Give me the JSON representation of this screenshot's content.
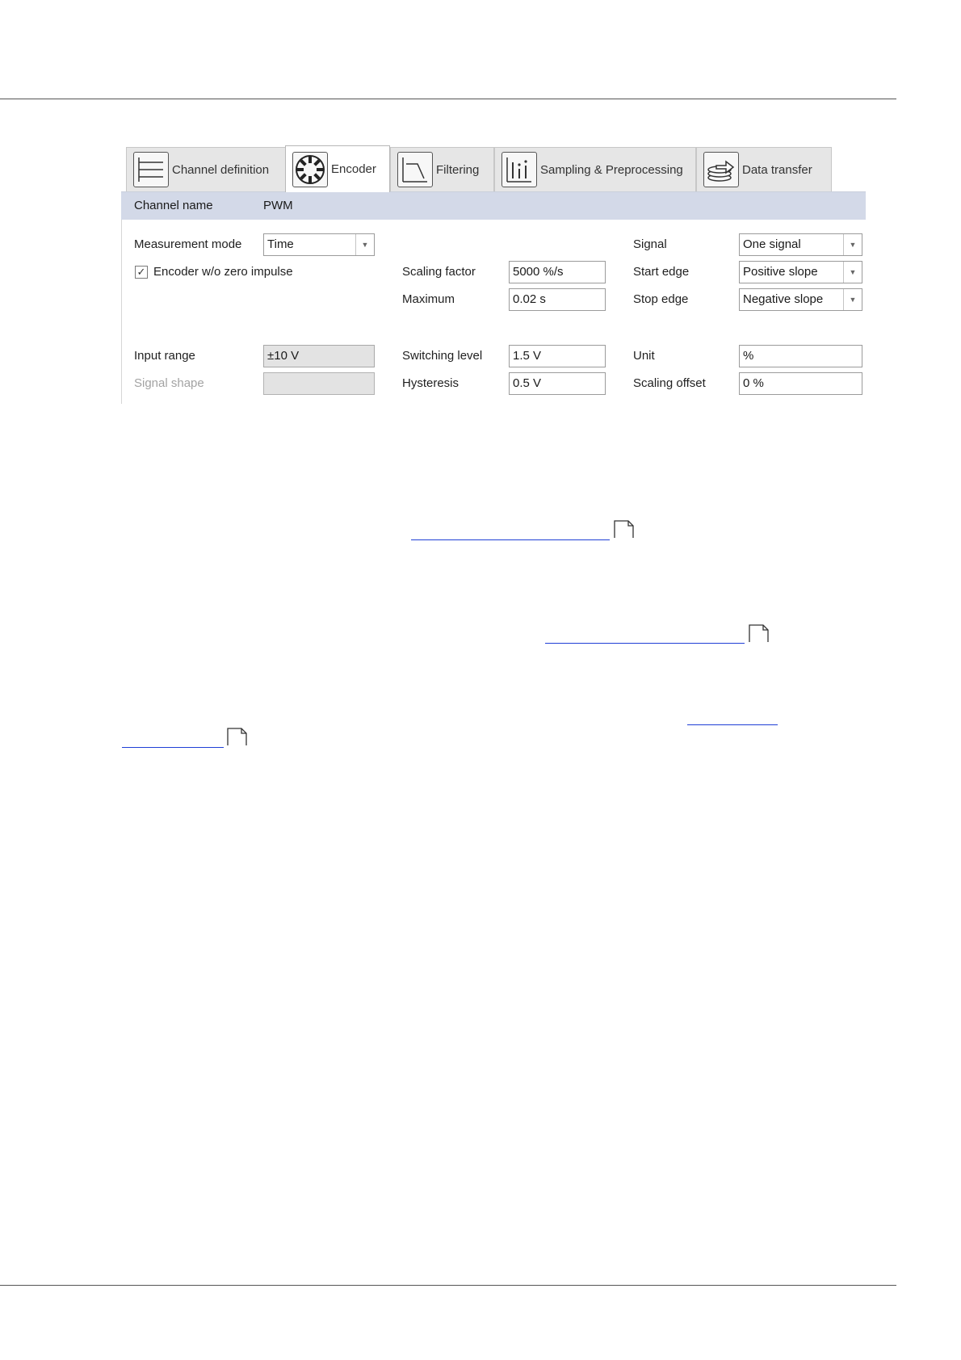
{
  "tabs": [
    {
      "label": "Channel definition",
      "icon": "channel-definition-icon",
      "active": false
    },
    {
      "label": "Encoder",
      "icon": "encoder-icon",
      "active": true
    },
    {
      "label": "Filtering",
      "icon": "filter-icon",
      "active": false
    },
    {
      "label": "Sampling & Preprocessing",
      "icon": "sampling-icon",
      "active": false
    },
    {
      "label": "Data transfer",
      "icon": "data-transfer-icon",
      "active": false
    }
  ],
  "channel": {
    "name_label": "Channel name",
    "name_value": "PWM"
  },
  "left": {
    "measurement_mode_label": "Measurement mode",
    "measurement_mode_value": "Time",
    "encoder_checkbox_label": "Encoder w/o zero impulse",
    "encoder_checkbox_mark": "✓",
    "input_range_label": "Input range",
    "input_range_value": "±10 V",
    "signal_shape_label": "Signal shape",
    "signal_shape_value": ""
  },
  "middle": {
    "scaling_factor_label": "Scaling factor",
    "scaling_factor_value": "5000 %/s",
    "maximum_label": "Maximum",
    "maximum_value": "0.02 s",
    "switching_level_label": "Switching level",
    "switching_level_value": "1.5 V",
    "hysteresis_label": "Hysteresis",
    "hysteresis_value": "0.5 V"
  },
  "right": {
    "signal_label": "Signal",
    "signal_value": "One signal",
    "start_edge_label": "Start edge",
    "start_edge_value": "Positive slope",
    "stop_edge_label": "Stop edge",
    "stop_edge_value": "Negative slope",
    "unit_label": "Unit",
    "unit_value": "%",
    "scaling_offset_label": "Scaling offset",
    "scaling_offset_value": "0 %"
  },
  "colors": {
    "namebar_bg": "#d3d9e8",
    "link": "#1f3fd6",
    "readonly_bg": "#e3e3e3"
  }
}
